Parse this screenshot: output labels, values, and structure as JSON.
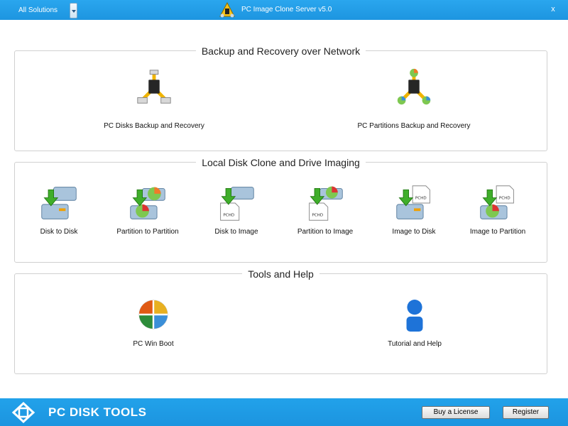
{
  "titlebar": {
    "solutions_label": "All Solutions",
    "window_title": "PC Image Clone Server v5.0",
    "close_label": "x"
  },
  "groups": {
    "network": {
      "title": "Backup and Recovery over Network",
      "items": [
        {
          "label": "PC Disks Backup and Recovery",
          "icon": "network-disks-icon"
        },
        {
          "label": "PC Partitions Backup and Recovery",
          "icon": "network-partitions-icon"
        }
      ]
    },
    "local": {
      "title": "Local Disk Clone and Drive Imaging",
      "items": [
        {
          "label": "Disk to Disk",
          "icon": "disk-to-disk-icon"
        },
        {
          "label": "Partition to Partition",
          "icon": "partition-to-partition-icon"
        },
        {
          "label": "Disk to Image",
          "icon": "disk-to-image-icon"
        },
        {
          "label": "Partition to Image",
          "icon": "partition-to-image-icon"
        },
        {
          "label": "Image to Disk",
          "icon": "image-to-disk-icon"
        },
        {
          "label": "Image to Partition",
          "icon": "image-to-partition-icon"
        }
      ],
      "image_file_label": "PCHD"
    },
    "tools": {
      "title": "Tools and Help",
      "items": [
        {
          "label": "PC Win Boot",
          "icon": "win-boot-icon"
        },
        {
          "label": "Tutorial and Help",
          "icon": "user-help-icon"
        }
      ]
    }
  },
  "footer": {
    "brand_name": "PC DISK TOOLS",
    "buy_label": "Buy a License",
    "register_label": "Register"
  },
  "colors": {
    "titlebar": "#1d95e0",
    "footer": "#1c94df",
    "arrow_green": "#3fae2a",
    "disk_blue": "#7fa6c8"
  }
}
